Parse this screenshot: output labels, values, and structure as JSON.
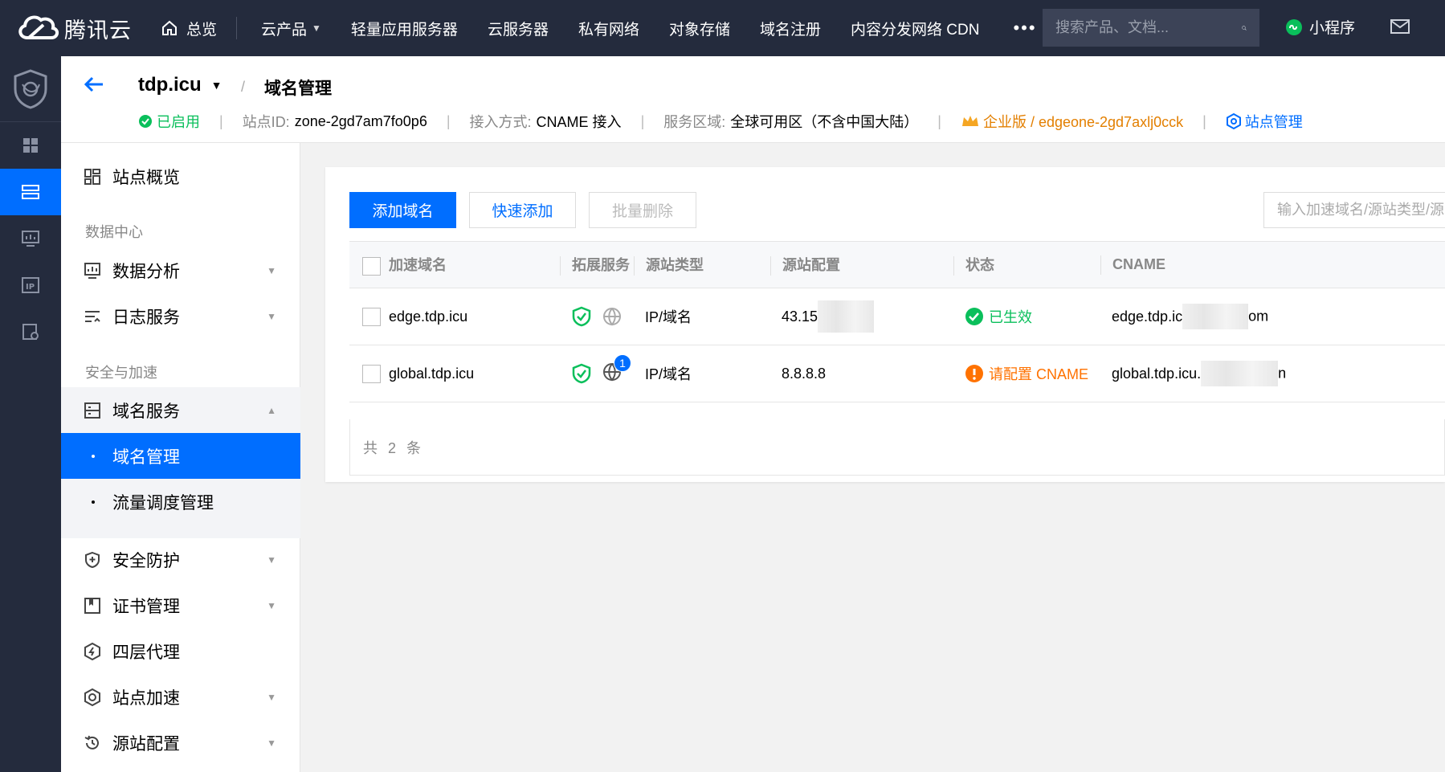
{
  "topbar": {
    "brand": "腾讯云",
    "home": "总览",
    "nav": [
      "云产品",
      "轻量应用服务器",
      "云服务器",
      "私有网络",
      "对象存储",
      "域名注册",
      "内容分发网络 CDN"
    ],
    "more": "•••",
    "search_placeholder": "搜索产品、文档...",
    "mini_program": "小程序"
  },
  "header": {
    "site": "tdp.icu",
    "crumb_sep": "/",
    "current": "域名管理",
    "status": "已启用",
    "site_id_label": "站点ID:",
    "site_id": "zone-2gd7am7fo0p6",
    "access_label": "接入方式:",
    "access": "CNAME 接入",
    "region_label": "服务区域:",
    "region": "全球可用区（不含中国大陆）",
    "plan": "企业版 / edgeone-2gd7axlj0cck",
    "manage": "站点管理"
  },
  "menu": {
    "overview": "站点概览",
    "group_data": "数据中心",
    "analytics": "数据分析",
    "logs": "日志服务",
    "group_sec": "安全与加速",
    "domain_service": "域名服务",
    "domain_manage": "域名管理",
    "traffic": "流量调度管理",
    "security": "安全防护",
    "cert": "证书管理",
    "l4": "四层代理",
    "accel": "站点加速",
    "origin": "源站配置"
  },
  "toolbar": {
    "add": "添加域名",
    "quick_add": "快速添加",
    "batch_delete": "批量删除",
    "search_placeholder": "输入加速域名/源站类型/源站"
  },
  "table": {
    "headers": [
      "加速域名",
      "拓展服务",
      "源站类型",
      "源站配置",
      "状态",
      "CNAME"
    ],
    "rows": [
      {
        "domain": "edge.tdp.icu",
        "origin_type": "IP/域名",
        "origin": "43.15",
        "status": "已生效",
        "status_kind": "ok",
        "cname_prefix": "edge.tdp.ic",
        "cname_suffix": "om",
        "badge": ""
      },
      {
        "domain": "global.tdp.icu",
        "origin_type": "IP/域名",
        "origin": "8.8.8.8",
        "status": "请配置 CNAME",
        "status_kind": "warn",
        "cname_prefix": "global.tdp.icu.",
        "cname_suffix": "n",
        "badge": "1"
      }
    ],
    "total": "共 2 条"
  },
  "colors": {
    "primary": "#006eff",
    "nav_bg": "#242b3d",
    "success": "#0abf5b",
    "warning": "#ff7200",
    "gold": "#e37f00"
  }
}
